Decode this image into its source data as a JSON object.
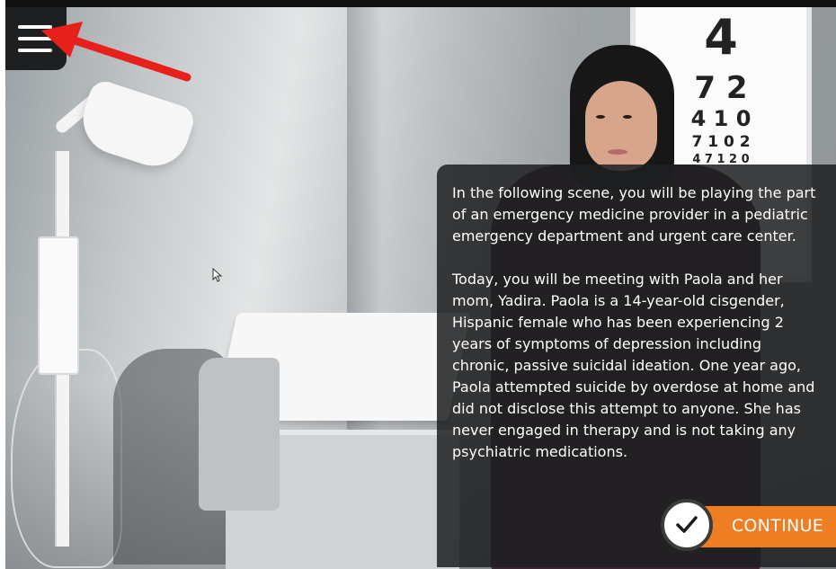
{
  "scene": {
    "eye_chart_rows": [
      "4",
      "7 2",
      "4 1 0",
      "7 1 0 2",
      "4 7 1 2 0"
    ]
  },
  "menu": {
    "icon": "hamburger-menu-icon"
  },
  "annotation": {
    "arrow_color": "#e8201c"
  },
  "dialog": {
    "paragraphs": [
      "In the following scene, you will be playing the part of  an emergency medicine provider in a pediatric emergency department and urgent care center.",
      "Today, you will be meeting with Paola and her mom, Yadira. Paola is a 14-year-old cisgender, Hispanic female who has been experiencing 2 years of symptoms of depression including chronic, passive suicidal ideation. One year ago, Paola attempted suicide by overdose at home and did not disclose this attempt to anyone. She has never engaged in therapy and is not taking any psychiatric medications."
    ],
    "continue_label": "CONTINUE",
    "continue_icon": "checkmark-icon",
    "accent_color": "#ef7d22"
  }
}
